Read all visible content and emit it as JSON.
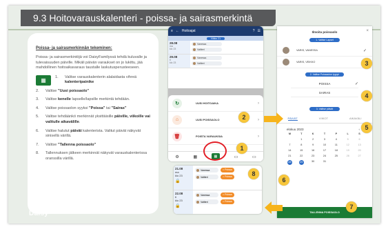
{
  "slide": {
    "title": "9.3 Hoitovarauskalenteri - poissa- ja sairasmerkintä",
    "footer_logo": "Daisy"
  },
  "instructions": {
    "heading": "Poissa- ja sairasmerkinnän tekeminen:",
    "intro": "Poissa- ja sairasmerkintöjä voi DaisyFamilyssä tehdä kuluvalle ja tulevaisuuden päiville. Mikäli päivän varaukset on jo lukittu, jää mahdollinen hoitoaikavaraus taustalle laskutusperusteeseen.",
    "steps": [
      {
        "num": "1.",
        "pre": "Valitse varauskalenterin alalaidasta vihreä ",
        "bold": "kalenteripainike",
        "post": ""
      },
      {
        "num": "2.",
        "pre": "Valitse ",
        "bold": "\"Uusi poissaolo\"",
        "post": ""
      },
      {
        "num": "3.",
        "pre": "Valitse ",
        "bold": "kenelle",
        "post": " lapselle/lapsille merkintä tehdään."
      },
      {
        "num": "4.",
        "pre": "Valitse poissaolon syyksi ",
        "bold": "\"Poissa\"",
        "post": " tai ",
        "bold2": "\"Sairas\""
      },
      {
        "num": "5.",
        "pre": "Valitse tehdäänkö merkinnät yksittäisille ",
        "bold": "päiville, viikoille vai valitulle aikavälille",
        "post": "."
      },
      {
        "num": "6.",
        "pre": "Valitse halutut ",
        "bold": "päivät",
        "post": " kalenterista. Valitut päivät näkyvät sinisellä värillä."
      },
      {
        "num": "7.",
        "pre": "Valitse ",
        "bold": "\"Tallenna poissaolo\"",
        "post": ""
      },
      {
        "num": "8.",
        "pre": "Tallennuksen jälkeen merkinnät näkyvät varauskalenterissa oranssilla värillä.",
        "bold": "",
        "post": ""
      }
    ]
  },
  "phone": {
    "header_title": "Hoitoajat",
    "week_label": "Viikko 21",
    "days": [
      {
        "date": "28.08",
        "weekday": "ma",
        "sub": "klo 23",
        "child1": "Vanessa",
        "child2": "Valtteri"
      },
      {
        "date": "29.08",
        "weekday": "ti",
        "sub": "klo 23",
        "child1": "Vanessa",
        "child2": "Valtteri"
      }
    ],
    "menu": [
      {
        "label": "UUSI HOITOAIKA",
        "icon": "↻",
        "color": "#1b7b35",
        "bg": "#e6f2e7"
      },
      {
        "label": "UUSI POISSAOLO",
        "icon": "⌂",
        "color": "#e8732a",
        "bg": "#fbeadf"
      },
      {
        "label": "POISTA VARAUKSIA",
        "icon": "🗑",
        "color": "#d32f2f",
        "bg": "#fde5e5"
      }
    ],
    "nav": [
      "⚙",
      "▦",
      "▦",
      "▭",
      "▭"
    ]
  },
  "modal": {
    "title": "Ilmoita poissaolo",
    "children_pill": "1. Valitse Lapset",
    "children": [
      {
        "name": "VARIS, VANESSA",
        "check": "✓"
      },
      {
        "name": "VARIS, VEIKKO",
        "check": "✓"
      }
    ],
    "type_pill": "2. Valitse Poissaolon tyyppi",
    "types": [
      {
        "label": "POISSA",
        "check": "✓"
      },
      {
        "label": "SAIRAS",
        "check": ""
      }
    ],
    "days_pill": "3. Valitse päivät",
    "tabs": [
      "PÄIVÄT",
      "VIIKOT",
      "AIKAVÄLI"
    ],
    "month": "elokuu 2023",
    "weekdays": [
      "M",
      "T",
      "K",
      "T",
      "P",
      "L",
      "S"
    ],
    "calendar": [
      [
        "",
        "1",
        "2",
        "3",
        "4",
        "5",
        "6"
      ],
      [
        "7",
        "8",
        "9",
        "10",
        "11",
        "12",
        "13"
      ],
      [
        "14",
        "15",
        "16",
        "17",
        "18",
        "19",
        "20"
      ],
      [
        "21",
        "22",
        "23",
        "24",
        "25",
        "26",
        "27"
      ],
      [
        "28",
        "29",
        "30",
        "31",
        "",
        "",
        ""
      ]
    ],
    "selected": [
      "28",
      "29"
    ],
    "save_label": "TALLENNA POISSAOLO"
  },
  "result": {
    "days": [
      {
        "date": "21.08",
        "weekday": "ma",
        "sub": "klo 23",
        "child1": "Vanessa",
        "child2": "Valtteri",
        "status": "Poissa"
      },
      {
        "date": "22.08",
        "weekday": "ti",
        "sub": "klo 23",
        "child1": "Vanessa",
        "child2": "Valtteri",
        "status": "Poissa"
      }
    ]
  },
  "badges": [
    "1",
    "2",
    "3",
    "4",
    "5",
    "6",
    "7",
    "8"
  ],
  "colors": {
    "accent_green": "#1b7b35",
    "accent_blue": "#2e6dc7",
    "badge": "#f7c63b",
    "absence": "#f28c28"
  }
}
